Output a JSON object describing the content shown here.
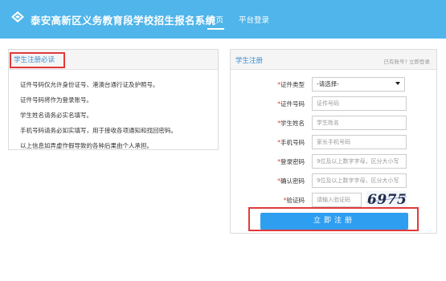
{
  "header": {
    "title": "泰安高新区义务教育段学校招生报名系统",
    "nav": [
      "首页",
      "平台登录"
    ],
    "colors": {
      "header_bg": "#4fb5ea",
      "accent": "#2e9ef0",
      "highlight": "#e03a3a"
    }
  },
  "notice": {
    "title": "学生注册必读",
    "items": [
      "证件号码仅允许身份证号、港澳台通行证及护照号。",
      "证件号码将作为登录账号。",
      "学生姓名请务必实名填写。",
      "手机号码请务必如实填写，用于接收各项通知和找回密码。",
      "以上信息如弄虚作假导致的各种后果由个人承担。"
    ]
  },
  "register": {
    "title": "学生注册",
    "has_account": "已有账号?",
    "login_link": "立即登录",
    "fields": {
      "id_type": {
        "label": "证件类型",
        "value": "-请选择-"
      },
      "id_number": {
        "label": "证件号码",
        "placeholder": "证件号码"
      },
      "student_name": {
        "label": "学生姓名",
        "placeholder": "学生姓名"
      },
      "phone": {
        "label": "手机号码",
        "placeholder": "家长手机号码"
      },
      "password": {
        "label": "登录密码",
        "placeholder": "9位及以上数字字母，区分大小写"
      },
      "confirm_password": {
        "label": "确认密码",
        "placeholder": "9位及以上数字字母，区分大小写"
      },
      "captcha": {
        "label": "验证码",
        "placeholder": "请输入验证码",
        "image_text": "6975"
      }
    },
    "required_mark": "*",
    "submit_label": "立即注册"
  }
}
